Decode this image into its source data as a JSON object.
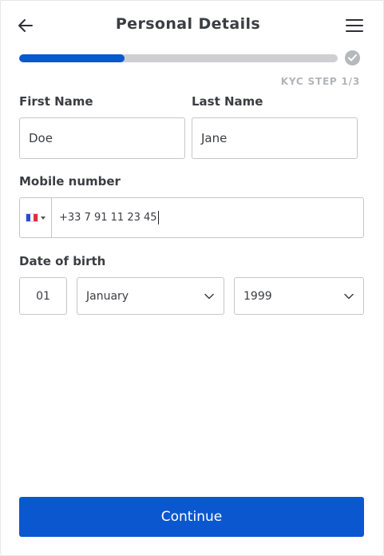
{
  "header": {
    "title": "Personal Details",
    "back_icon": "arrow-left-icon",
    "menu_icon": "hamburger-menu-icon"
  },
  "progress": {
    "fraction": 0.33,
    "step_label": "KYC STEP 1/3",
    "colors": {
      "fill": "#0b57d0",
      "track": "#cfcfd1"
    }
  },
  "form": {
    "first_name": {
      "label": "First Name",
      "value": "Doe"
    },
    "last_name": {
      "label": "Last Name",
      "value": "Jane"
    },
    "mobile": {
      "label": "Mobile number",
      "country_flag": "france-flag-icon",
      "value": "+33 7 91 11 23 45"
    },
    "dob": {
      "label": "Date of birth",
      "day": "01",
      "month": "January",
      "year": "1999"
    }
  },
  "actions": {
    "continue_label": "Continue"
  },
  "colors": {
    "primary": "#0b57d0",
    "text": "#3b3d42",
    "border": "#c5c6ca"
  }
}
